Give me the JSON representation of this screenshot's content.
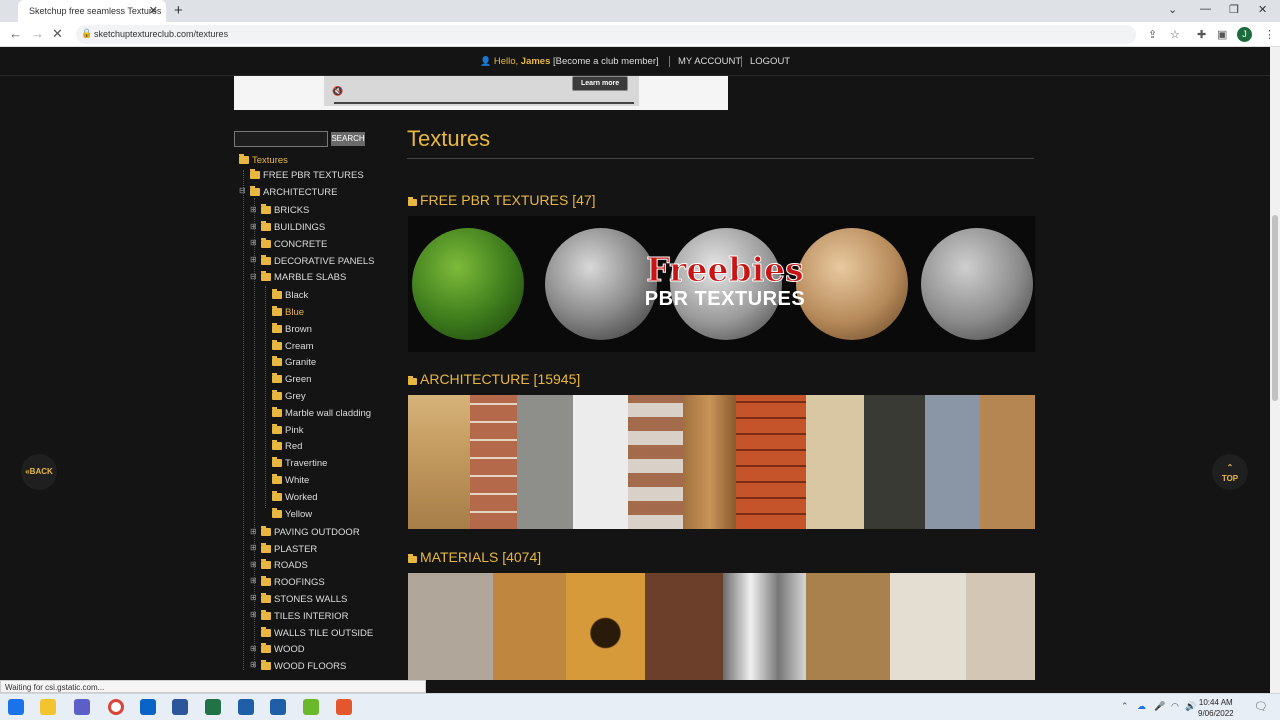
{
  "browser": {
    "tab_title": "Sketchup free seamless Textures",
    "url": "sketchuptextureclub.com/textures",
    "status_text": "Waiting for csi.gstatic.com...",
    "avatar_letter": "J"
  },
  "header": {
    "hello": "Hello,",
    "user": "James",
    "member_link": "[Become a club member]",
    "account": "MY ACCOUNT",
    "logout": "LOGOUT"
  },
  "ad": {
    "learn_more": "Learn more"
  },
  "search": {
    "button": "SEARCH",
    "placeholder": ""
  },
  "tree": {
    "root": "Textures",
    "free_pbr": "FREE PBR TEXTURES",
    "architecture": "ARCHITECTURE",
    "arch_items": [
      "BRICKS",
      "BUILDINGS",
      "CONCRETE",
      "DECORATIVE PANELS",
      "MARBLE SLABS"
    ],
    "marble_items": [
      "Black",
      "Blue",
      "Brown",
      "Cream",
      "Granite",
      "Green",
      "Grey",
      "Marble wall cladding",
      "Pink",
      "Red",
      "Travertine",
      "White",
      "Worked",
      "Yellow"
    ],
    "more_items": [
      "PAVING OUTDOOR",
      "PLASTER",
      "ROADS",
      "ROOFINGS",
      "STONES WALLS",
      "TILES INTERIOR",
      "WALLS TILE OUTSIDE",
      "WOOD",
      "WOOD FLOORS"
    ]
  },
  "main": {
    "title": "Textures",
    "sections": [
      {
        "label": "FREE PBR TEXTURES [47]"
      },
      {
        "label": "ARCHITECTURE [15945]"
      },
      {
        "label": "MATERIALS [4074]"
      }
    ],
    "pbr_banner": {
      "line1": "Freebies",
      "line2": "PBR TEXTURES"
    }
  },
  "nav": {
    "back": "«BACK",
    "top_arrow": "⌃",
    "top": "TOP"
  },
  "clock": {
    "time": "10:44 AM",
    "date": "9/06/2022"
  },
  "colors": {
    "accent": "#e8b742",
    "background": "#141414"
  }
}
